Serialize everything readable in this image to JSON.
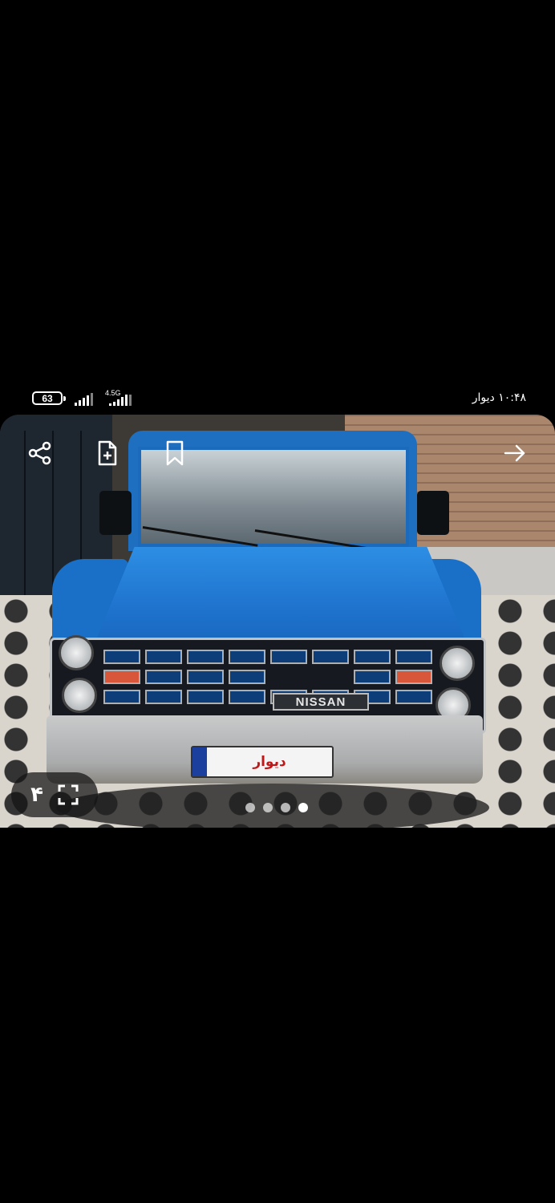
{
  "status_bar": {
    "battery": "63",
    "network": "4.5G",
    "time": "۱۰:۴۸ دیوار"
  },
  "gallery": {
    "current_index": "۴",
    "total_images": 4,
    "active_dot": 4,
    "license_plate_text": "دیوار",
    "vehicle_badge": "NISSAN"
  },
  "toolbar": {
    "icons": [
      "share-icon",
      "add-note-icon",
      "bookmark-icon",
      "forward-arrow-icon"
    ]
  }
}
